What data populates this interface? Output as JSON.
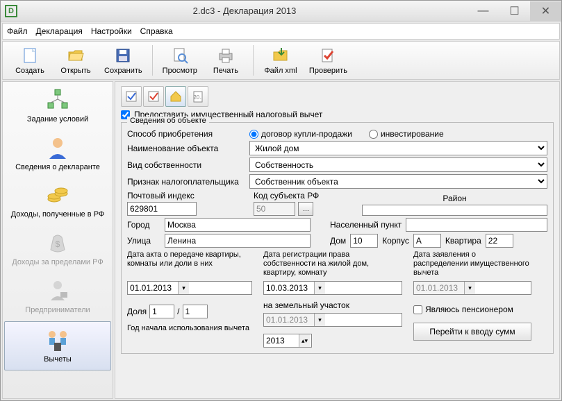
{
  "window": {
    "title": "2.dc3 - Декларация 2013"
  },
  "menu": {
    "file": "Файл",
    "decl": "Декларация",
    "settings": "Настройки",
    "help": "Справка"
  },
  "toolbar": {
    "create": "Создать",
    "open": "Открыть",
    "save": "Сохранить",
    "preview": "Просмотр",
    "print": "Печать",
    "filexml": "Файл xml",
    "check": "Проверить"
  },
  "sidebar": {
    "items": [
      "Задание условий",
      "Сведения о декларанте",
      "Доходы, полученные в РФ",
      "Доходы за пределами РФ",
      "Предприниматели",
      "Вычеты"
    ]
  },
  "checkbox_label": "Предоставить имущественный налоговый вычет",
  "fieldset_title": "Сведения об объекте",
  "labels": {
    "acq_method": "Способ приобретения",
    "radio_dogovor": "договор купли-продажи",
    "radio_invest": "инвестирование",
    "object_name": "Наименование объекта",
    "ownership": "Вид собственности",
    "taxpayer_sign": "Признак налогоплательщика",
    "postcode": "Почтовый индекс",
    "region_code": "Код субъекта РФ",
    "district": "Район",
    "city": "Город",
    "locality": "Населенный пункт",
    "street": "Улица",
    "house": "Дом",
    "building": "Корпус",
    "flat": "Квартира",
    "date_act": "Дата акта о передаче квартиры, комнаты или доли в них",
    "date_reg": "Дата регистрации права собственности на жилой дом, квартиру, комнату",
    "date_land": "на земельный участок",
    "date_appl": "Дата заявления о распределении имущественного вычета",
    "share": "Доля",
    "year_start": "Год начала использования вычета",
    "pensioner": "Являюсь пенсионером",
    "goto_sums": "Перейти к вводу сумм"
  },
  "values": {
    "object_name": "Жилой дом",
    "ownership": "Собственность",
    "taxpayer_sign": "Собственник объекта",
    "postcode": "629801",
    "region_code": "50",
    "district": "",
    "city": "Москва",
    "locality": "",
    "street": "Ленина",
    "house": "10",
    "building": "А",
    "flat": "22",
    "date_act": "01.01.2013",
    "date_reg": "10.03.2013",
    "date_land": "01.01.2013",
    "date_appl": "01.01.2013",
    "share_num": "1",
    "share_den": "1",
    "year_start": "2013"
  }
}
